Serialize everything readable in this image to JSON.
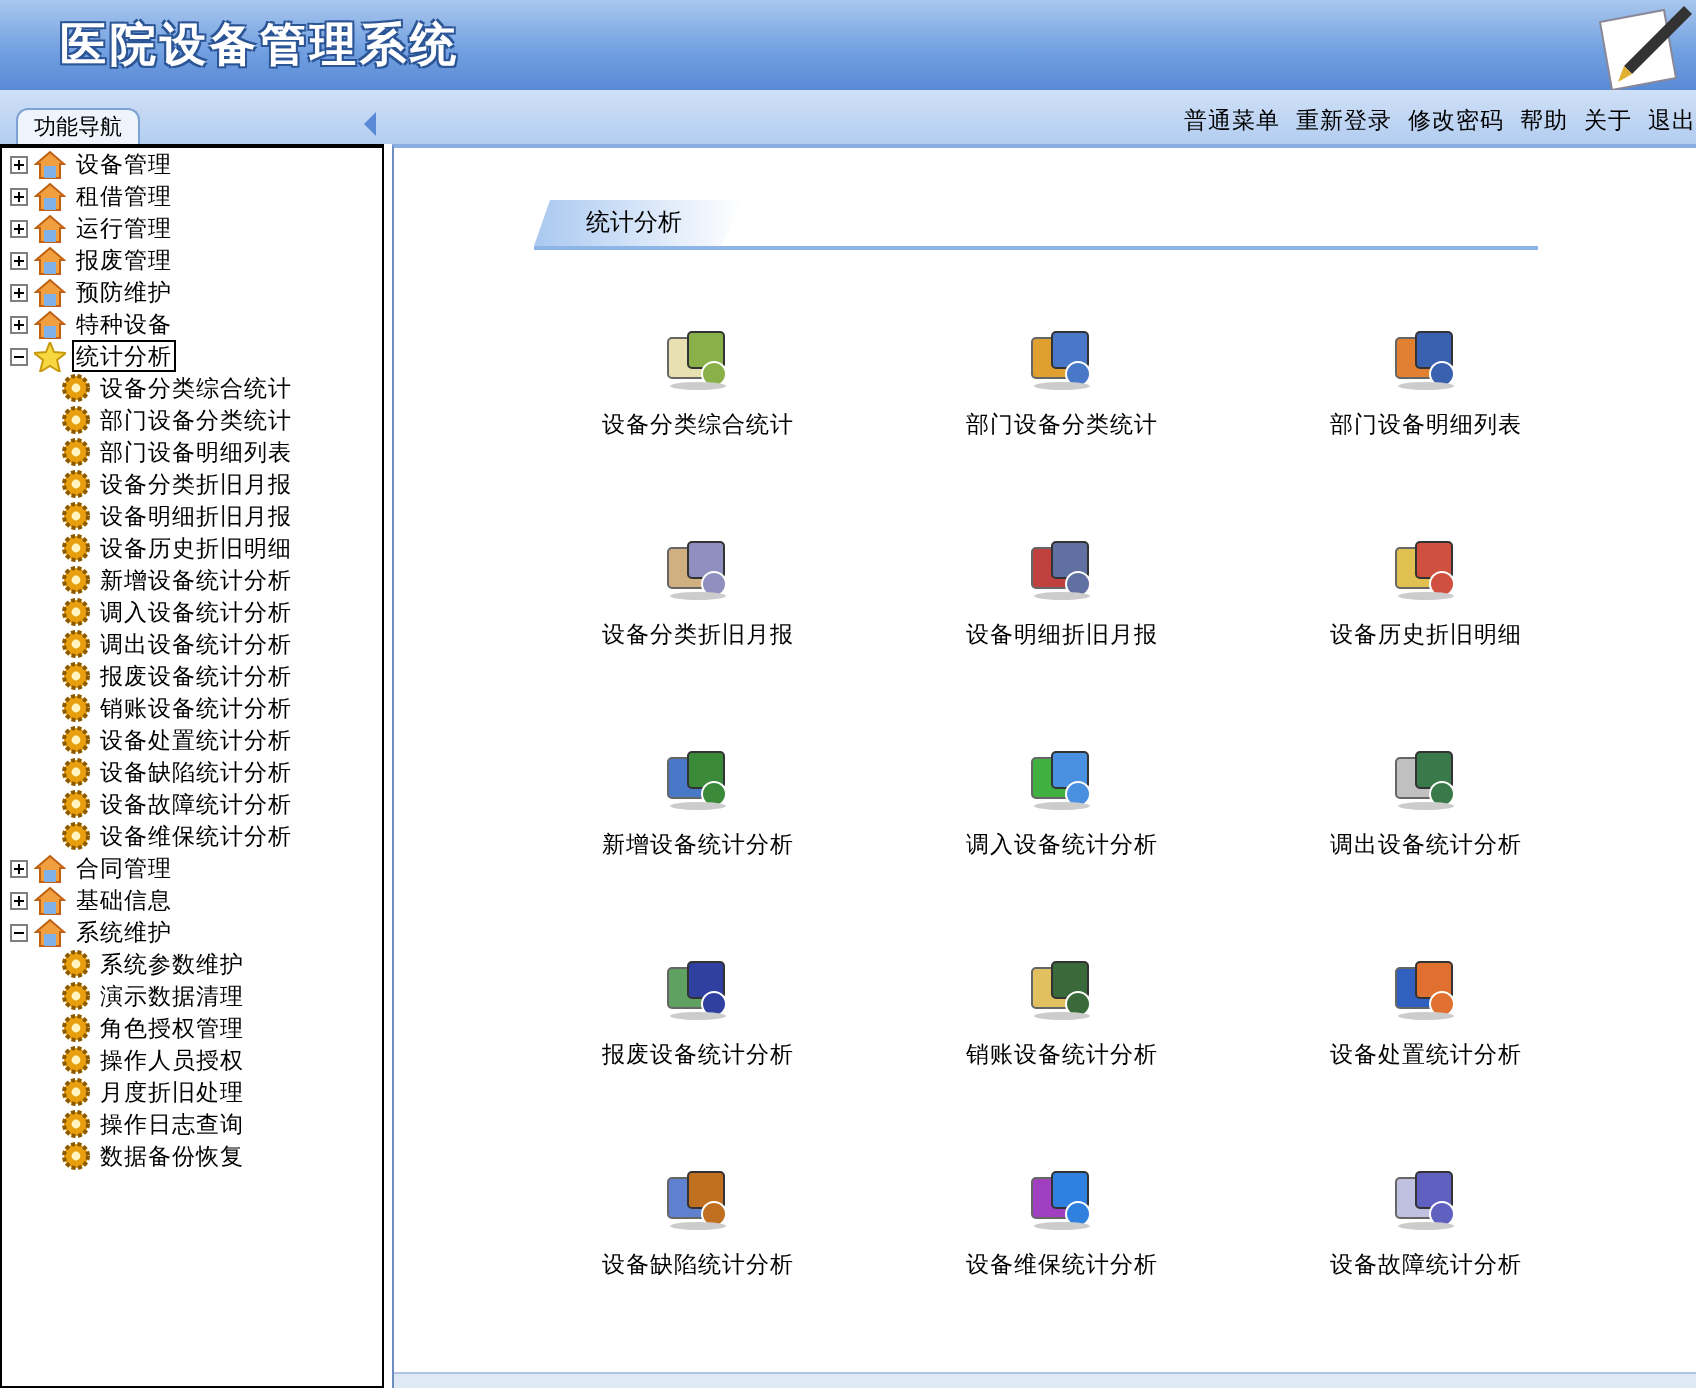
{
  "window": {
    "title": "医院设备管理系统"
  },
  "nav_tab": "功能导航",
  "top_links": [
    "普通菜单",
    "重新登录",
    "修改密码",
    "帮助",
    "关于",
    "退出"
  ],
  "tree": [
    {
      "label": "设备管理",
      "expanded": false,
      "selected": false
    },
    {
      "label": "租借管理",
      "expanded": false,
      "selected": false
    },
    {
      "label": "运行管理",
      "expanded": false,
      "selected": false
    },
    {
      "label": "报废管理",
      "expanded": false,
      "selected": false
    },
    {
      "label": "预防维护",
      "expanded": false,
      "selected": false
    },
    {
      "label": "特种设备",
      "expanded": false,
      "selected": false
    },
    {
      "label": "统计分析",
      "expanded": true,
      "selected": true,
      "children": [
        {
          "label": "设备分类综合统计"
        },
        {
          "label": "部门设备分类统计"
        },
        {
          "label": "部门设备明细列表"
        },
        {
          "label": "设备分类折旧月报"
        },
        {
          "label": "设备明细折旧月报"
        },
        {
          "label": "设备历史折旧明细"
        },
        {
          "label": "新增设备统计分析"
        },
        {
          "label": "调入设备统计分析"
        },
        {
          "label": "调出设备统计分析"
        },
        {
          "label": "报废设备统计分析"
        },
        {
          "label": "销账设备统计分析"
        },
        {
          "label": "设备处置统计分析"
        },
        {
          "label": "设备缺陷统计分析"
        },
        {
          "label": "设备故障统计分析"
        },
        {
          "label": "设备维保统计分析"
        }
      ]
    },
    {
      "label": "合同管理",
      "expanded": false,
      "selected": false
    },
    {
      "label": "基础信息",
      "expanded": false,
      "selected": false
    },
    {
      "label": "系统维护",
      "expanded": true,
      "selected": false,
      "children": [
        {
          "label": "系统参数维护"
        },
        {
          "label": "演示数据清理"
        },
        {
          "label": "角色授权管理"
        },
        {
          "label": "操作人员授权"
        },
        {
          "label": "月度折旧处理"
        },
        {
          "label": "操作日志查询"
        },
        {
          "label": "数据备份恢复"
        }
      ]
    }
  ],
  "section_title": "统计分析",
  "tiles": [
    "设备分类综合统计",
    "部门设备分类统计",
    "部门设备明细列表",
    "设备分类折旧月报",
    "设备明细折旧月报",
    "设备历史折旧明细",
    "新增设备统计分析",
    "调入设备统计分析",
    "调出设备统计分析",
    "报废设备统计分析",
    "销账设备统计分析",
    "设备处置统计分析",
    "设备缺陷统计分析",
    "设备维保统计分析",
    "设备故障统计分析"
  ]
}
